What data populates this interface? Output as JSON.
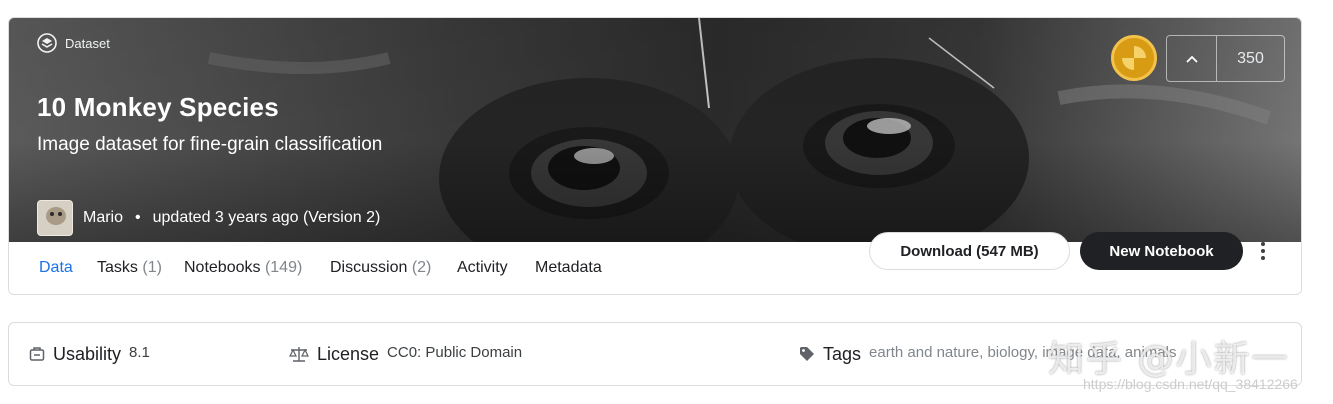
{
  "header": {
    "type_label": "Dataset",
    "title": "10 Monkey Species",
    "subtitle": "Image dataset for fine-grain classification",
    "author": "Mario",
    "separator": "•",
    "updated": "updated 3 years ago (Version 2)",
    "upvotes": "350"
  },
  "tabs": [
    {
      "label": "Data",
      "count": ""
    },
    {
      "label": "Tasks",
      "count": "(1)"
    },
    {
      "label": "Notebooks",
      "count": "(149)"
    },
    {
      "label": "Discussion",
      "count": "(2)"
    },
    {
      "label": "Activity",
      "count": ""
    },
    {
      "label": "Metadata",
      "count": ""
    }
  ],
  "actions": {
    "download_label": "Download (547 MB)",
    "new_notebook_label": "New Notebook"
  },
  "info": {
    "usability_label": "Usability",
    "usability_value": "8.1",
    "license_label": "License",
    "license_value": "CC0: Public Domain",
    "tags_label": "Tags",
    "tags_value": "earth and nature, biology, image data, animals"
  },
  "watermark": {
    "text": "知乎 @小新一",
    "url": "https://blog.csdn.net/qq_38412266"
  },
  "icons": {
    "dataset": "dataset-icon",
    "medal": "gold-medal-icon",
    "upvote": "chevron-up-icon",
    "more": "more-vert-icon",
    "usability": "usability-icon",
    "license": "scale-icon",
    "tags": "tag-icon"
  },
  "colors": {
    "accent": "#1a73e8",
    "primary_button": "#202124",
    "medal": "#d89b14"
  }
}
